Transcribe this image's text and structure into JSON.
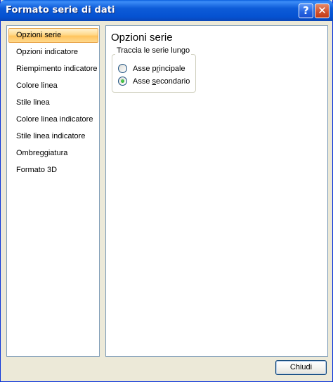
{
  "window": {
    "title": "Formato serie di dati",
    "help_glyph": "?",
    "close_glyph": "✕"
  },
  "nav": {
    "items": [
      {
        "label": "Opzioni serie",
        "selected": true
      },
      {
        "label": "Opzioni indicatore"
      },
      {
        "label": "Riempimento indicatore"
      },
      {
        "label": "Colore linea"
      },
      {
        "label": "Stile linea"
      },
      {
        "label": "Colore linea indicatore"
      },
      {
        "label": "Stile linea indicatore"
      },
      {
        "label": "Ombreggiatura"
      },
      {
        "label": "Formato 3D"
      }
    ]
  },
  "content": {
    "section_title": "Opzioni serie",
    "group_label": "Traccia le serie lungo",
    "radios": [
      {
        "label_pre": "Asse p",
        "mnemonic": "r",
        "label_post": "incipale",
        "checked": false
      },
      {
        "label_pre": "Asse ",
        "mnemonic": "s",
        "label_post": "econdario",
        "checked": true
      }
    ]
  },
  "footer": {
    "close_label": "Chiudi"
  },
  "colors": {
    "titlebar": "#0552d1",
    "selection": "#ffd98a",
    "dialog_bg": "#ece9d8",
    "radio_dot": "#21a121"
  }
}
